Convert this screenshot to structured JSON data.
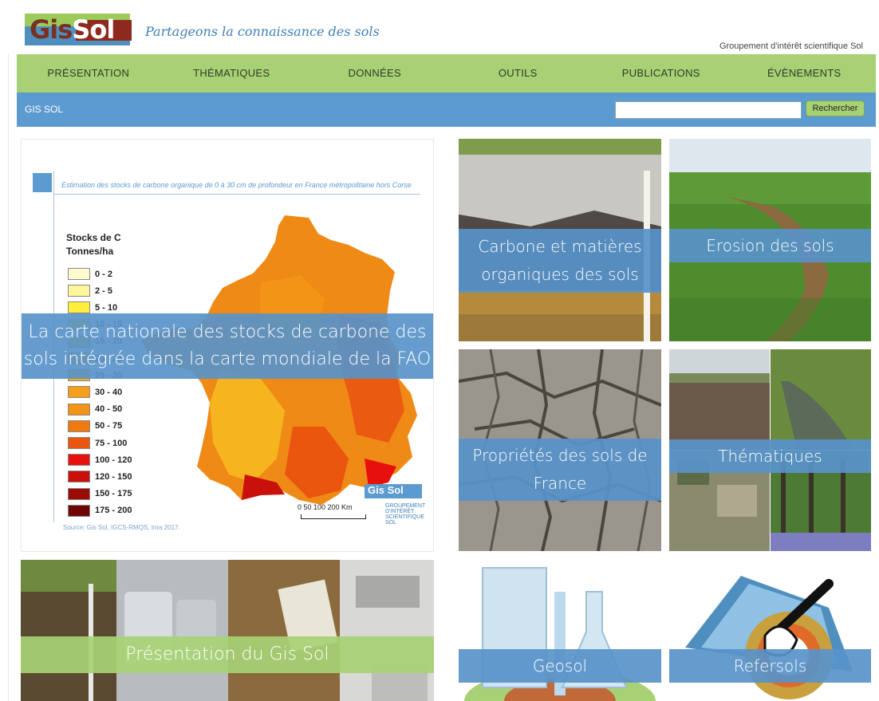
{
  "header": {
    "logo_text_a": "Gis",
    "logo_text_b": "Sol",
    "tagline": "Partageons la connaissance des sols",
    "subtitle": "Groupement d'intérêt scientifique Sol"
  },
  "nav": {
    "items": [
      {
        "label": "PRÉSENTATION"
      },
      {
        "label": "THÉMATIQUES"
      },
      {
        "label": "DONNÉES"
      },
      {
        "label": "OUTILS"
      },
      {
        "label": "PUBLICATIONS"
      },
      {
        "label": "ÉVÈNEMENTS"
      }
    ]
  },
  "subbar": {
    "breadcrumb": "GIS SOL",
    "search_value": "",
    "search_button": "Rechercher"
  },
  "tiles": {
    "map_title": "Estimation des stocks de carbone organique de 0 à 30 cm de profondeur en France métropolitaine hors Corse",
    "legend_title_1": "Stocks de C",
    "legend_title_2": "Tonnes/ha",
    "legend": [
      {
        "label": "0 - 2",
        "color": "#fffbd0"
      },
      {
        "label": "2 - 5",
        "color": "#fff59a"
      },
      {
        "label": "5 - 10",
        "color": "#ffee3a"
      },
      {
        "label": "10 - 15",
        "color": "#fde02c"
      },
      {
        "label": "15 - 20",
        "color": "#fbcf26"
      },
      {
        "label": "20 - 25",
        "color": "#f8bf22"
      },
      {
        "label": "25 - 30",
        "color": "#f6ae1e"
      },
      {
        "label": "30 - 40",
        "color": "#f4a01a"
      },
      {
        "label": "40 - 50",
        "color": "#f39416"
      },
      {
        "label": "50 - 75",
        "color": "#ef7a12"
      },
      {
        "label": "75 - 100",
        "color": "#ea560e"
      },
      {
        "label": "100 - 120",
        "color": "#e8100c"
      },
      {
        "label": "120 - 150",
        "color": "#c9100b"
      },
      {
        "label": "150 - 175",
        "color": "#9c0a08"
      },
      {
        "label": "175 - 200",
        "color": "#6e0606"
      }
    ],
    "map_source": "Source: Gis Sol, IGCS-RMQS, Inra 2017.",
    "scale_label": "0 50 100 200 Km",
    "mini_logo": "Gis Sol",
    "mini_logo_sub": "GROUPEMENT D'INTÉRÊT SCIENTIFIQUE SOL",
    "map_caption": "La carte nationale des stocks de carbone des sols intégrée dans la carte mondiale de la FAO",
    "presentation": "Présentation du Gis Sol",
    "carbone": "Carbone et matières organiques des sols",
    "erosion": "Erosion des sols",
    "proprietes": "Propriétés des sols de France",
    "thematiques": "Thématiques",
    "geosol": "Geosol",
    "refersols": "Refersols"
  }
}
